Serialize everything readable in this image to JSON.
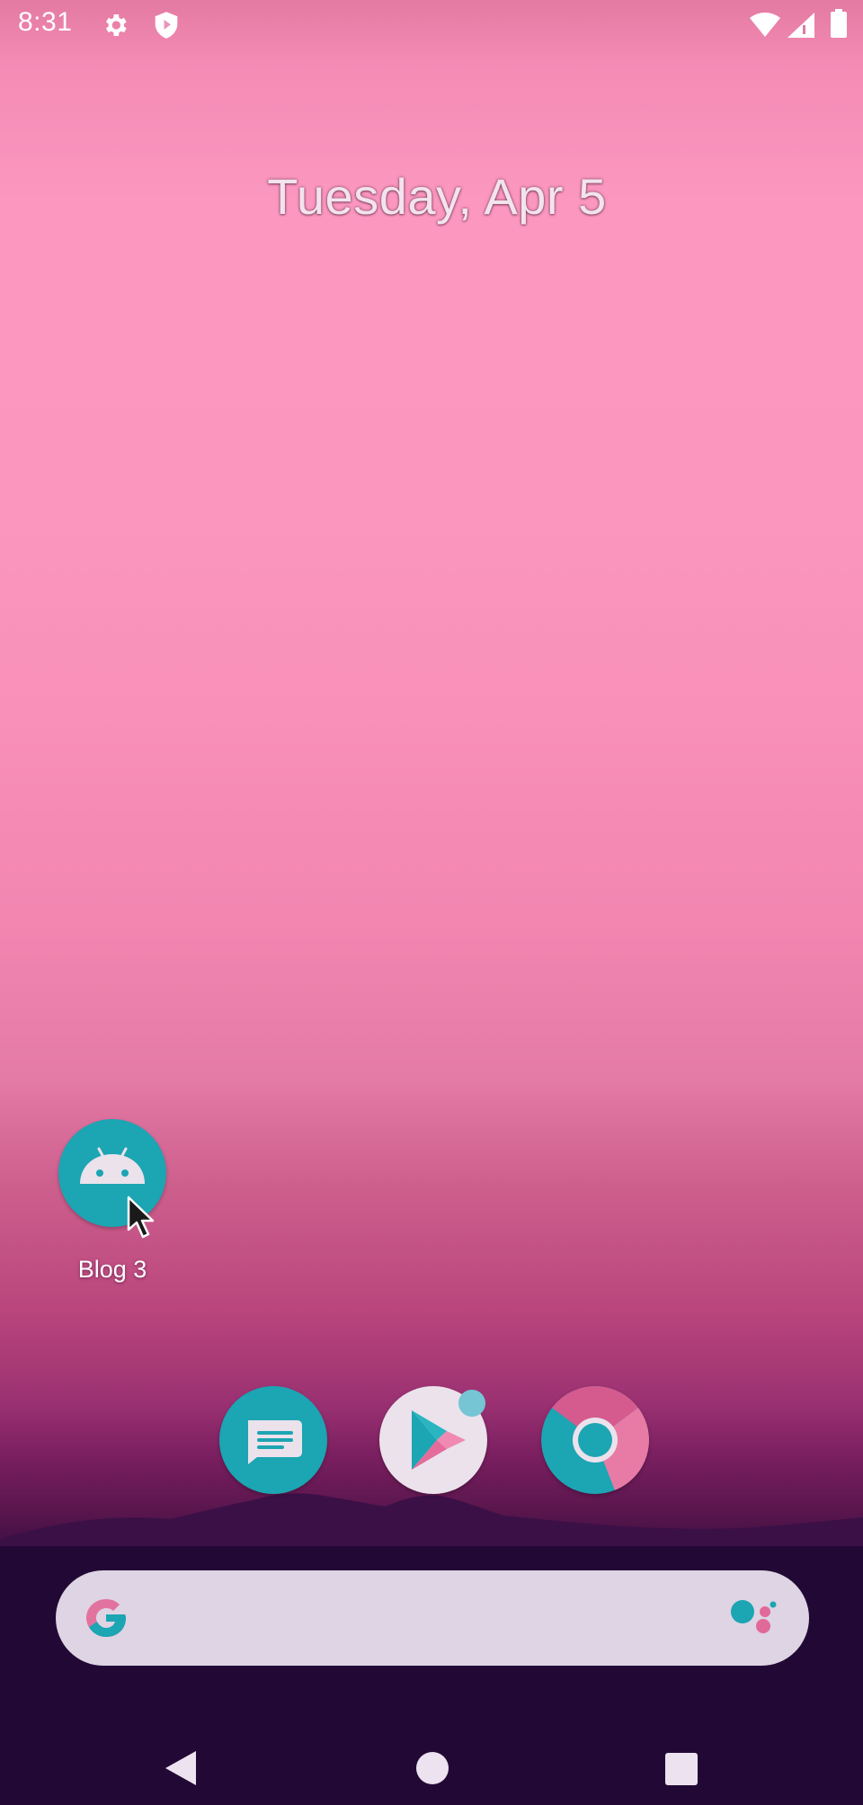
{
  "status_bar": {
    "time": "8:31",
    "icons": [
      "settings-icon",
      "shield-icon",
      "wifi-icon",
      "cellular-signal-icon",
      "battery-icon"
    ]
  },
  "home": {
    "date": "Tuesday, Apr 5",
    "apps": [
      {
        "label": "Blog 3",
        "icon": "android-icon"
      }
    ]
  },
  "dock": {
    "apps": [
      "messages-icon",
      "play-store-icon",
      "chrome-icon"
    ]
  },
  "search_bar": {
    "icons": [
      "google-g-icon",
      "assistant-icon"
    ]
  },
  "nav_bar": {
    "icons": [
      "back-icon",
      "home-icon",
      "recents-icon"
    ]
  },
  "colors": {
    "accent_teal": "#1ca5b3",
    "wallpaper_pink": "#fc98c0",
    "wallpaper_dark": "#220935"
  }
}
